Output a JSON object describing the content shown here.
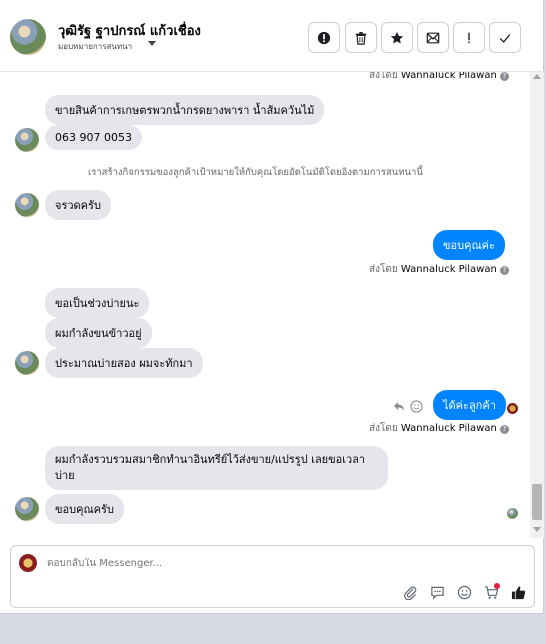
{
  "header": {
    "name": "วุฒิรัฐ ฐาปกรณ์ แก้วเชื่อง",
    "assign_label": "มอบหมายการสนทนา",
    "actions": [
      "report-icon",
      "trash-icon",
      "star-icon",
      "mark-unread-icon",
      "follow-up-icon",
      "done-icon"
    ]
  },
  "chat": {
    "sent_by_prefix": "ส่งโดย",
    "sent_by_name": "Wannaluck Pilawan",
    "messages": {
      "m1": "ขายสินค้าการเกษตรพวกน้ำกรดยางพารา น้ำส้มควันไม้",
      "m2": "063 907 0053",
      "system": "เราสร้างกิจกรรมของลูกค้าเป้าหมายให้กับคุณโดยอัตโนมัติโดยอิงตามการสนทนานี้",
      "m3": "จรวดครับ",
      "m4": "ขอบคุณค่ะ",
      "m5": "ขอเป็นช่วงบ่ายนะ",
      "m6": "ผมกำลังขนข้าวอยู่",
      "m7": "ประมาณบ่ายสอง ผมจะทักมา",
      "m8": "ได้ค่ะลูกค้า",
      "m9_line1": "ผมกำลังรวบรวมสมาชิกทำนาอินทรีย์ไว้ส่งขาย/แปรรูป เลยขอเวลา",
      "m9_line2": "บ่าย",
      "m10": "ขอบคุณครับ"
    }
  },
  "composer": {
    "placeholder": "ตอบกลับใน Messenger...",
    "icons": [
      "attach-icon",
      "saved-reply-icon",
      "emoji-icon",
      "cart-icon",
      "like-icon"
    ]
  },
  "colors": {
    "outgoing_bubble": "#0084ff",
    "incoming_bubble": "#e4e6eb",
    "notification_dot": "#e41e3f"
  }
}
